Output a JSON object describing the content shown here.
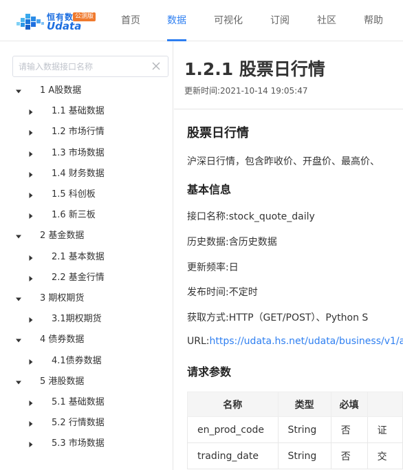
{
  "header": {
    "logo": {
      "name": "恒有数",
      "name_en": "Udata",
      "badge": "公测版"
    },
    "nav": [
      {
        "label": "首页",
        "active": false
      },
      {
        "label": "数据",
        "active": true
      },
      {
        "label": "可视化",
        "active": false
      },
      {
        "label": "订阅",
        "active": false
      },
      {
        "label": "社区",
        "active": false
      },
      {
        "label": "帮助",
        "active": false
      }
    ]
  },
  "sidebar": {
    "search": {
      "placeholder": "请输入数据接口名称",
      "value": ""
    },
    "tree": [
      {
        "label": "1 A股数据",
        "level": 0,
        "expanded": true
      },
      {
        "label": "1.1 基础数据",
        "level": 1,
        "expanded": false
      },
      {
        "label": "1.2 市场行情",
        "level": 1,
        "expanded": false
      },
      {
        "label": "1.3 市场数据",
        "level": 1,
        "expanded": false
      },
      {
        "label": "1.4 财务数据",
        "level": 1,
        "expanded": false
      },
      {
        "label": "1.5 科创板",
        "level": 1,
        "expanded": false
      },
      {
        "label": "1.6 新三板",
        "level": 1,
        "expanded": false
      },
      {
        "label": "2 基金数据",
        "level": 0,
        "expanded": true
      },
      {
        "label": "2.1 基本数据",
        "level": 1,
        "expanded": false
      },
      {
        "label": "2.2 基金行情",
        "level": 1,
        "expanded": false
      },
      {
        "label": "3 期权期货",
        "level": 0,
        "expanded": true
      },
      {
        "label": "3.1期权期货",
        "level": 1,
        "expanded": false
      },
      {
        "label": "4 债券数据",
        "level": 0,
        "expanded": true
      },
      {
        "label": "4.1债券数据",
        "level": 1,
        "expanded": false
      },
      {
        "label": "5 港股数据",
        "level": 0,
        "expanded": true
      },
      {
        "label": "5.1 基础数据",
        "level": 1,
        "expanded": false
      },
      {
        "label": "5.2 行情数据",
        "level": 1,
        "expanded": false
      },
      {
        "label": "5.3 市场数据",
        "level": 1,
        "expanded": false
      }
    ]
  },
  "main": {
    "title": "1.2.1 股票日行情",
    "updated_label": "更新时间:",
    "updated_value": "2021-10-14 19:05:47",
    "section_title": "股票日行情",
    "description": "沪深日行情，包含昨收价、开盘价、最高价、",
    "basic_info_title": "基本信息",
    "info": [
      {
        "label": "接口名称:",
        "value": "stock_quote_daily"
      },
      {
        "label": "历史数据:",
        "value": "含历史数据"
      },
      {
        "label": "更新频率:",
        "value": "日"
      },
      {
        "label": "发布时间:",
        "value": "不定时"
      },
      {
        "label": "获取方式:",
        "value": "HTTP（GET/POST）、Python S"
      }
    ],
    "url_label": "URL:",
    "url": "https://udata.hs.net/udata/business/v1/a",
    "params_title": "请求参数",
    "params_table": {
      "headers": [
        "名称",
        "类型",
        "必填",
        ""
      ],
      "rows": [
        [
          "en_prod_code",
          "String",
          "否",
          "证"
        ],
        [
          "trading_date",
          "String",
          "否",
          "交"
        ]
      ]
    }
  },
  "colors": {
    "accent": "#2e7ff1",
    "logo": "#1e6fe0",
    "badge": "#f07a2e"
  }
}
